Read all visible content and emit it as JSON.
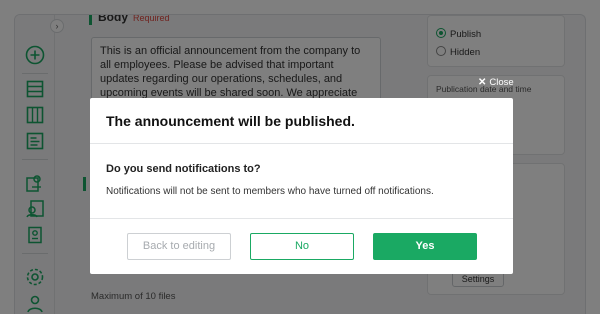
{
  "editor": {
    "body_label": "Body",
    "required_label": "Required",
    "body_text": "This is an official announcement from the company to all employees. Please be advised that important updates regarding our operations, schedules, and upcoming events will be shared soon. We appreciate your attention and",
    "max_files_note": "Maximum of 10 files"
  },
  "right_panel": {
    "publish_label": "Publish",
    "hidden_label": "Hidden",
    "publication_label": "Publication date and time",
    "settings_button": "Settings"
  },
  "modal": {
    "close_label": "Close",
    "title": "The announcement will be published.",
    "question": "Do you send notifications to?",
    "note": "Notifications will not be sent to members who have turned off notifications.",
    "back_button": "Back to editing",
    "no_button": "No",
    "yes_button": "Yes"
  },
  "icons": {
    "sidebar": [
      "add-icon",
      "list-icon",
      "columns-icon",
      "document-icon",
      "user-card-icon",
      "user-file-icon",
      "user-badge-icon",
      "gear-icon",
      "person-icon"
    ],
    "collapse": "chevron-right-icon",
    "close": "close-icon"
  },
  "colors": {
    "accent": "#1aa963",
    "required": "#e0473f",
    "overlay": "rgba(0,0,0,0.5)"
  }
}
